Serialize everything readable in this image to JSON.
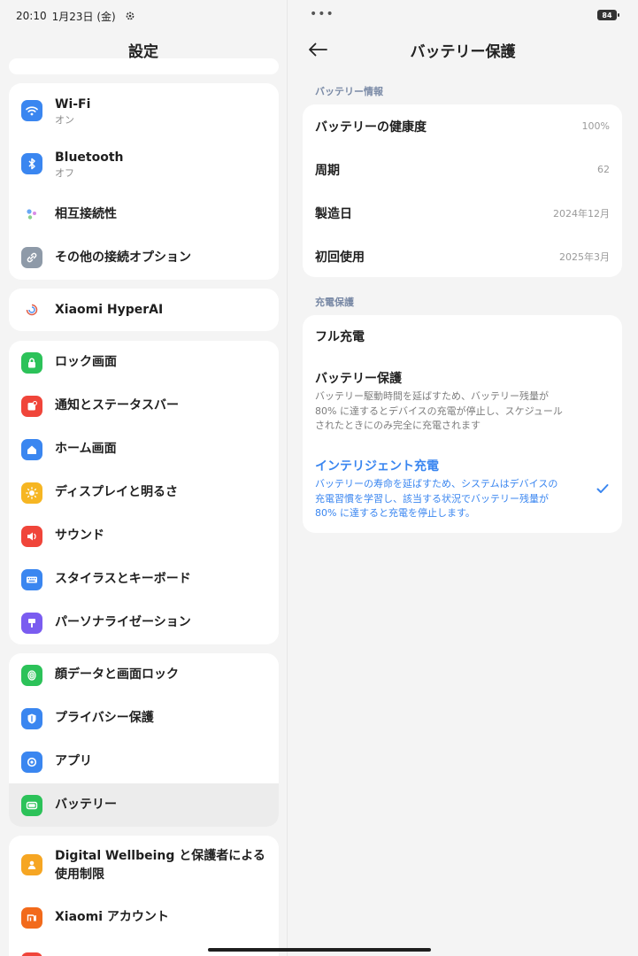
{
  "status_bar": {
    "time": "20:10",
    "date": "1月23日 (金)",
    "battery_level": "84"
  },
  "left": {
    "title": "設定",
    "groups": [
      {
        "items": [
          {
            "label": "Wi-Fi",
            "sub": "オン",
            "icon": "wifi-icon",
            "color": "#3a86f0"
          },
          {
            "label": "Bluetooth",
            "sub": "オフ",
            "icon": "bluetooth-icon",
            "color": "#3a86f0"
          },
          {
            "label": "相互接続性",
            "sub": "",
            "icon": "interconnect-icon",
            "color": "#ffffff"
          },
          {
            "label": "その他の接続オプション",
            "sub": "",
            "icon": "link-icon",
            "color": "#8e9aa8"
          }
        ]
      },
      {
        "items": [
          {
            "label": "Xiaomi HyperAI",
            "sub": "",
            "icon": "hyperai-icon",
            "color": "#ffffff"
          }
        ]
      },
      {
        "items": [
          {
            "label": "ロック画面",
            "sub": "",
            "icon": "lock-icon",
            "color": "#2cc259"
          },
          {
            "label": "通知とステータスバー",
            "sub": "",
            "icon": "notification-icon",
            "color": "#f0453a"
          },
          {
            "label": "ホーム画面",
            "sub": "",
            "icon": "home-icon",
            "color": "#3a86f0"
          },
          {
            "label": "ディスプレイと明るさ",
            "sub": "",
            "icon": "sun-icon",
            "color": "#f6b623"
          },
          {
            "label": "サウンド",
            "sub": "",
            "icon": "speaker-icon",
            "color": "#f0453a"
          },
          {
            "label": "スタイラスとキーボード",
            "sub": "",
            "icon": "keyboard-icon",
            "color": "#3a86f0"
          },
          {
            "label": "パーソナライゼーション",
            "sub": "",
            "icon": "brush-icon",
            "color": "#7a5cf0"
          }
        ]
      },
      {
        "items": [
          {
            "label": "顔データと画面ロック",
            "sub": "",
            "icon": "fingerprint-icon",
            "color": "#2cc259"
          },
          {
            "label": "プライバシー保護",
            "sub": "",
            "icon": "privacy-icon",
            "color": "#3a86f0"
          },
          {
            "label": "アプリ",
            "sub": "",
            "icon": "apps-icon",
            "color": "#3a86f0"
          },
          {
            "label": "バッテリー",
            "sub": "",
            "icon": "battery-icon",
            "color": "#2cc259"
          }
        ]
      },
      {
        "items": [
          {
            "label": "Digital Wellbeing と保護者による",
            "label2": "使用制限",
            "sub": "",
            "icon": "wellbeing-icon",
            "color": "#f6a623"
          },
          {
            "label": "Xiaomi アカウント",
            "sub": "",
            "icon": "mi-icon",
            "color": "#f26a1b"
          }
        ]
      }
    ]
  },
  "right": {
    "title": "バッテリー保護",
    "info_section": "バッテリー情報",
    "info_rows": [
      {
        "key": "バッテリーの健康度",
        "value": "100%"
      },
      {
        "key": "周期",
        "value": "62"
      },
      {
        "key": "製造日",
        "value": "2024年12月"
      },
      {
        "key": "初回使用",
        "value": "2025年3月"
      }
    ],
    "charge_section": "充電保護",
    "options": [
      {
        "title": "フル充電",
        "lines": []
      },
      {
        "title": "バッテリー保護",
        "lines": [
          "バッテリー駆動時間を延ばすため、バッテリー残量が",
          "80% に達するとデバイスの充電が停止し、スケジュール",
          "されたときにのみ完全に充電されます"
        ]
      },
      {
        "title": "インテリジェント充電",
        "lines": [
          "バッテリーの寿命を延ばすため、システムはデバイスの",
          "充電習慣を学習し、該当する状況でバッテリー残量が",
          "80% に達すると充電を停止します。"
        ]
      }
    ],
    "selected_option": "インテリジェント充電"
  }
}
